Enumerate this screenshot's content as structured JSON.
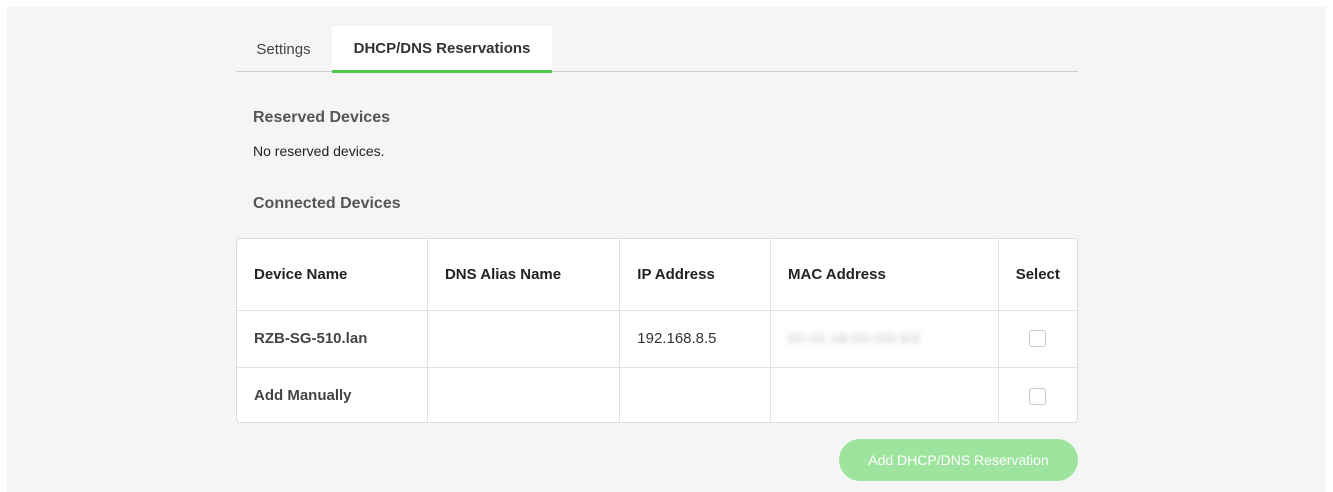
{
  "tabs": [
    {
      "label": "Settings",
      "active": false
    },
    {
      "label": "DHCP/DNS Reservations",
      "active": true
    }
  ],
  "reserved": {
    "heading": "Reserved Devices",
    "empty_text": "No reserved devices."
  },
  "connected": {
    "heading": "Connected Devices",
    "columns": [
      "Device Name",
      "DNS Alias Name",
      "IP Address",
      "MAC Address",
      "Select"
    ],
    "rows": [
      {
        "device_name": "RZB-SG-510.lan",
        "dns_alias": "",
        "ip_address": "192.168.8.5",
        "mac_address": "00:05:1B:D0:DD:ED",
        "selected": false
      },
      {
        "device_name": "Add Manually",
        "dns_alias": "",
        "ip_address": "",
        "mac_address": "",
        "selected": false
      }
    ]
  },
  "actions": {
    "add_button_label": "Add DHCP/DNS Reservation"
  },
  "colors": {
    "accent": "#4ec94e",
    "button_disabled": "#9ee39e"
  }
}
